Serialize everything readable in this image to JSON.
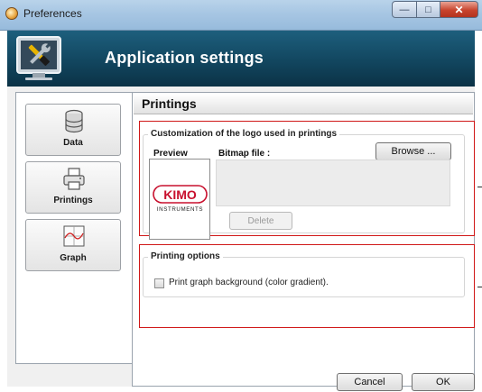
{
  "window": {
    "title": "Preferences",
    "controls": {
      "minimize": "—",
      "maximize": "□",
      "close": "✕"
    }
  },
  "header": {
    "title": "Application settings",
    "icon": "tools-icon"
  },
  "sidebar": {
    "items": [
      {
        "label": "Data",
        "icon": "database-icon"
      },
      {
        "label": "Printings",
        "icon": "printer-icon",
        "selected": true
      },
      {
        "label": "Graph",
        "icon": "graph-icon"
      }
    ]
  },
  "main": {
    "section_title": "Printings",
    "logo_group": {
      "title": "Customization of the logo used in printings",
      "preview_label": "Preview",
      "bitmap_label": "Bitmap file :",
      "browse_label": "Browse ...",
      "delete_label": "Delete",
      "logo": {
        "brand": "KIMO",
        "sub": "INSTRUMENTS",
        "brand_color": "#c8102e"
      }
    },
    "printing_options": {
      "title": "Printing options",
      "checkbox_label": "Print graph background (color gradient).",
      "checked": false
    }
  },
  "footer": {
    "cancel_label": "Cancel",
    "ok_label": "OK"
  },
  "colors": {
    "header_bg": "#12465f",
    "highlight_border": "#d01818"
  }
}
